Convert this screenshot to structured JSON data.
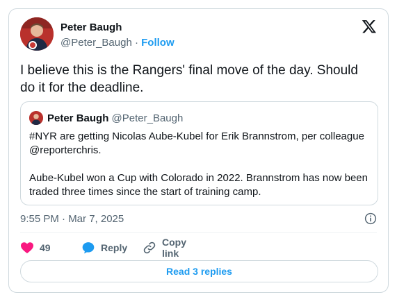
{
  "author": {
    "name": "Peter Baugh",
    "handle": "@Peter_Baugh",
    "separator": "·",
    "follow_label": "Follow"
  },
  "tweet": {
    "text": "I believe this is the Rangers' final move of the day. Should do it for the deadline.",
    "timestamp": "9:55 PM · Mar 7, 2025"
  },
  "quoted_tweet": {
    "name": "Peter Baugh",
    "handle": "@Peter_Baugh",
    "paragraph1": "#NYR are getting Nicolas Aube-Kubel for Erik Brannstrom, per colleague @reporterchris.",
    "paragraph2": "Aube-Kubel won a Cup with Colorado in 2022. Brannstrom has now been traded three times since the start of training camp."
  },
  "actions": {
    "like_count": "49",
    "reply_label": "Reply",
    "copy_link_label": "Copy link"
  },
  "read_replies_label": "Read 3 replies",
  "icons": {
    "brand": "x-logo-icon",
    "like": "heart-icon",
    "reply": "speech-bubble-icon",
    "copy_link": "link-icon",
    "info": "info-icon"
  },
  "colors": {
    "accent": "#1d9bf0",
    "like": "#f91880",
    "secondary_text": "#536471",
    "border": "#cfd9de"
  }
}
